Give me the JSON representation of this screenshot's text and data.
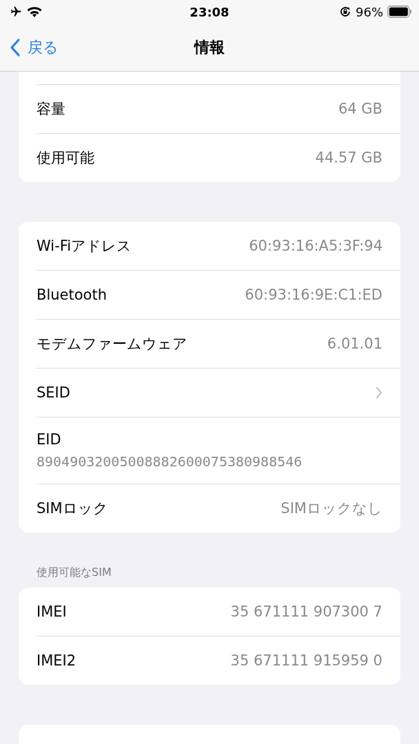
{
  "status_bar": {
    "time": "23:08",
    "battery": "96%",
    "airplane_mode": true,
    "wifi": true,
    "rotation_lock": true
  },
  "nav": {
    "back": "戻る",
    "title": "情報"
  },
  "groups": [
    {
      "rows": [
        {
          "kind": "value",
          "label": "容量",
          "value": "64 GB"
        },
        {
          "kind": "value",
          "label": "使用可能",
          "value": "44.57 GB"
        }
      ]
    },
    {
      "rows": [
        {
          "kind": "value",
          "label": "Wi-Fiアドレス",
          "value": "60:93:16:A5:3F:94"
        },
        {
          "kind": "value",
          "label": "Bluetooth",
          "value": "60:93:16:9E:C1:ED"
        },
        {
          "kind": "value",
          "label": "モデムファームウェア",
          "value": "6.01.01"
        },
        {
          "kind": "link",
          "label": "SEID"
        },
        {
          "kind": "stacked",
          "label": "EID",
          "value": "89049032005008882600075380988546"
        },
        {
          "kind": "value",
          "label": "SIMロック",
          "value": "SIMロックなし"
        }
      ]
    },
    {
      "header": "使用可能なSIM",
      "rows": [
        {
          "kind": "value",
          "label": "IMEI",
          "value": "35 671111 907300 7"
        },
        {
          "kind": "value",
          "label": "IMEI2",
          "value": "35 671111 915959 0"
        }
      ]
    }
  ]
}
